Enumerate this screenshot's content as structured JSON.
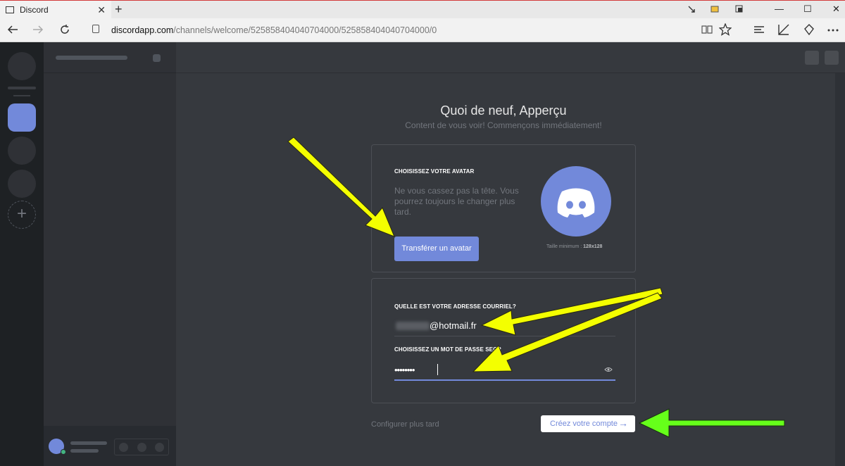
{
  "browser": {
    "tab_title": "Discord",
    "close_glyph": "✕",
    "new_tab_glyph": "+",
    "url_host": "discordapp.com",
    "url_path": "/channels/welcome/525858404040704000/525858404040704000/0",
    "icons": [
      "back-icon",
      "forward-icon",
      "refresh-icon",
      "lock-icon",
      "reading-view-icon",
      "favorite-icon",
      "hub-icon",
      "web-note-icon",
      "share-icon",
      "more-icon"
    ]
  },
  "window": {
    "minimize": "—",
    "maximize": "☐",
    "close": "✕"
  },
  "guild_sidebar": {
    "add_glyph": "+"
  },
  "welcome": {
    "title": "Quoi de neuf, Apperçu",
    "subtitle": "Content de vous voir! Commençons immédiatement!"
  },
  "avatar_section": {
    "label": "CHOISISSEZ VOTRE AVATAR",
    "hint_line1": "Ne vous cassez pas la tête. Vous",
    "hint_line2": "pourrez toujours le changer plus",
    "hint_line3": "tard.",
    "upload_button": "Transférer un avatar",
    "min_size_label": "Taille minimum :",
    "min_size_value": "128x128"
  },
  "account_section": {
    "email_label": "QUELLE EST VOTRE ADRESSE COURRIEL?",
    "email_value": "@hotmail.fr",
    "password_label": "CHOISISSEZ UN MOT DE PASSE SECR",
    "password_value": "••••••••",
    "show_password_icon": "eye-icon"
  },
  "footer": {
    "configure_later": "Configurer plus tard",
    "create_account": "Créez votre compte",
    "arrow_glyph": "→"
  },
  "colors": {
    "blurple": "#7289da",
    "annotation_yellow": "#f4ff00",
    "annotation_green": "#66ff1a",
    "background": "#36393e"
  }
}
